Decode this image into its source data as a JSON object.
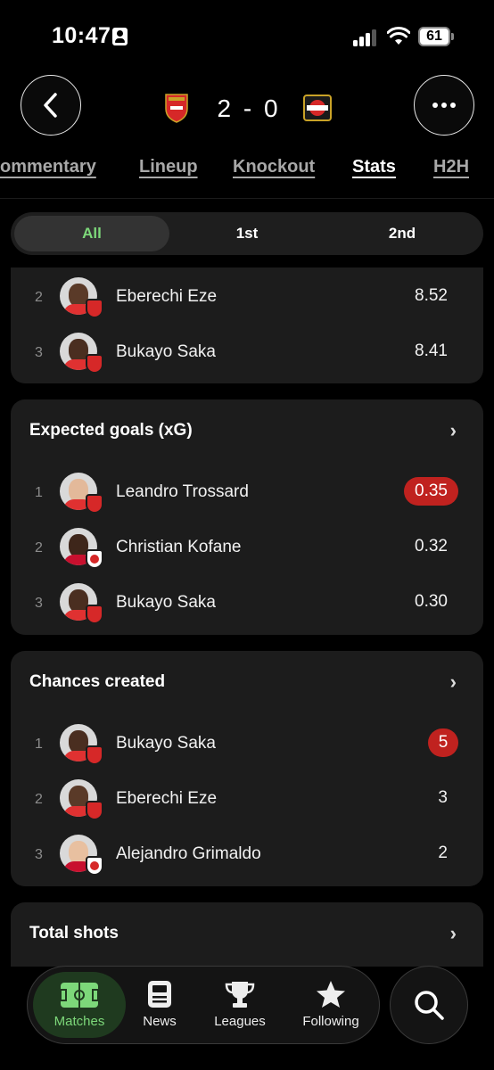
{
  "status_bar": {
    "time": "10:47",
    "battery": "61"
  },
  "match": {
    "home_score": "2",
    "separator": "-",
    "away_score": "0",
    "score_text": "2 - 0"
  },
  "tabs": [
    {
      "label": "ommentary"
    },
    {
      "label": "Lineup"
    },
    {
      "label": "Knockout"
    },
    {
      "label": "Stats",
      "active": true
    },
    {
      "label": "H2H"
    }
  ],
  "periods": [
    {
      "label": "All",
      "active": true
    },
    {
      "label": "1st"
    },
    {
      "label": "2nd"
    }
  ],
  "top_card": {
    "rows": [
      {
        "rank": "2",
        "name": "Eberechi Eze",
        "value": "8.52",
        "team": "Arsenal"
      },
      {
        "rank": "3",
        "name": "Bukayo Saka",
        "value": "8.41",
        "team": "Arsenal"
      }
    ]
  },
  "xg_card": {
    "title": "Expected goals (xG)",
    "rows": [
      {
        "rank": "1",
        "name": "Leandro Trossard",
        "value": "0.35",
        "team": "Arsenal",
        "highlight": true
      },
      {
        "rank": "2",
        "name": "Christian Kofane",
        "value": "0.32",
        "team": "Leverkusen"
      },
      {
        "rank": "3",
        "name": "Bukayo Saka",
        "value": "0.30",
        "team": "Arsenal"
      }
    ]
  },
  "chances_card": {
    "title": "Chances created",
    "rows": [
      {
        "rank": "1",
        "name": "Bukayo Saka",
        "value": "5",
        "team": "Arsenal",
        "highlight": true
      },
      {
        "rank": "2",
        "name": "Eberechi Eze",
        "value": "3",
        "team": "Arsenal"
      },
      {
        "rank": "3",
        "name": "Alejandro Grimaldo",
        "value": "2",
        "team": "Leverkusen"
      }
    ]
  },
  "shots_card": {
    "title": "Total shots"
  },
  "nav": {
    "items": [
      {
        "label": "Matches",
        "icon": "pitch-icon",
        "active": true
      },
      {
        "label": "News",
        "icon": "news-icon"
      },
      {
        "label": "Leagues",
        "icon": "trophy-icon"
      },
      {
        "label": "Following",
        "icon": "star-icon"
      }
    ]
  },
  "colors": {
    "background": "#000000",
    "card": "#1c1c1c",
    "accent_green": "#7dd87a",
    "highlight_red": "#c0221f"
  }
}
